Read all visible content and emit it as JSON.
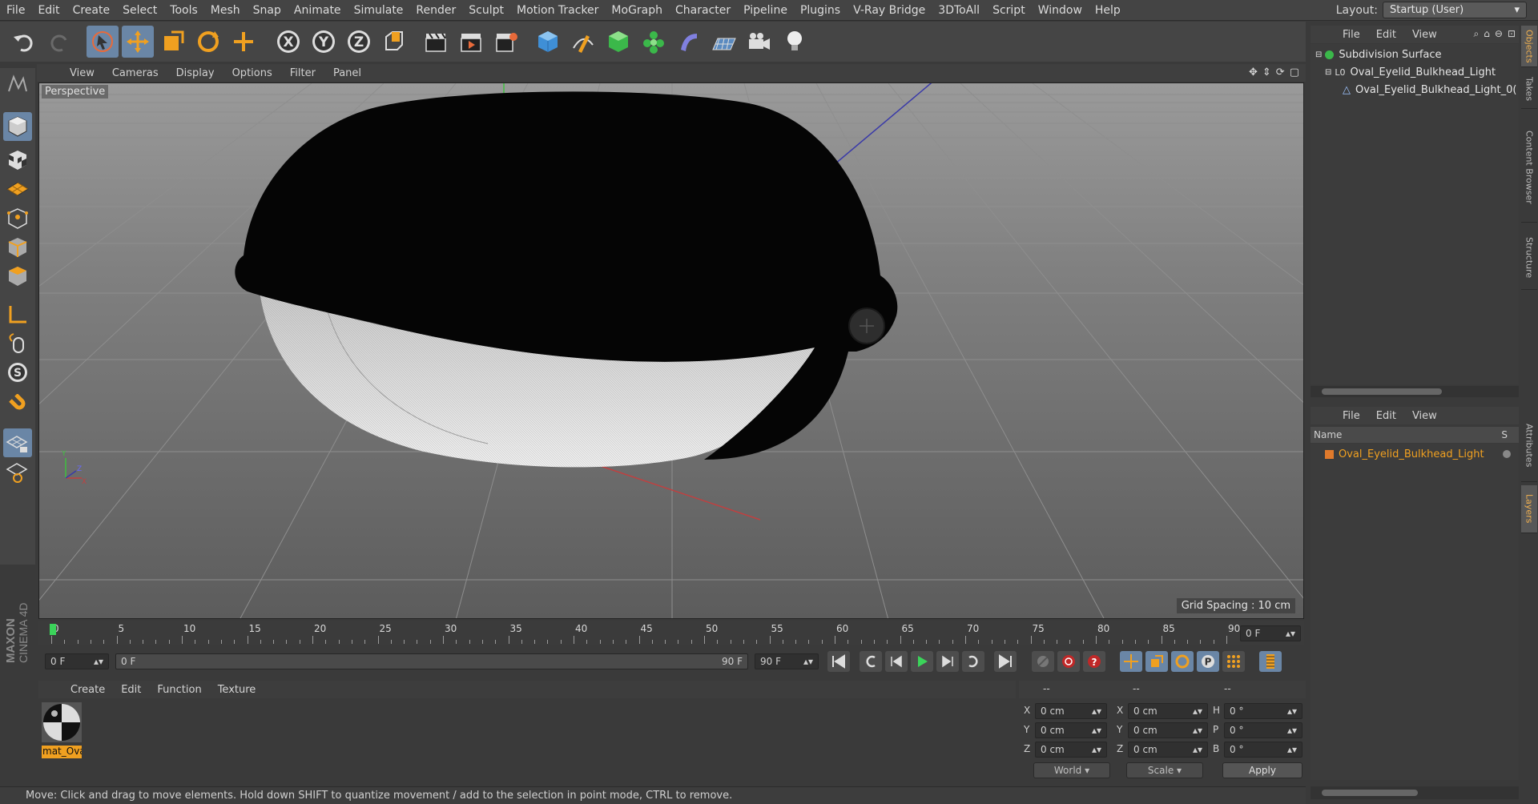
{
  "menubar": {
    "items": [
      "File",
      "Edit",
      "Create",
      "Select",
      "Tools",
      "Mesh",
      "Snap",
      "Animate",
      "Simulate",
      "Render",
      "Sculpt",
      "Motion Tracker",
      "MoGraph",
      "Character",
      "Pipeline",
      "Plugins",
      "V-Ray Bridge",
      "3DToAll",
      "Script",
      "Window",
      "Help"
    ],
    "layout_label": "Layout:",
    "layout_value": "Startup (User)"
  },
  "viewport": {
    "menu": [
      "View",
      "Cameras",
      "Display",
      "Options",
      "Filter",
      "Panel"
    ],
    "label": "Perspective",
    "grid_spacing": "Grid Spacing : 10 cm"
  },
  "timeline": {
    "ticks": [
      "0",
      "5",
      "10",
      "15",
      "20",
      "25",
      "30",
      "35",
      "40",
      "45",
      "50",
      "55",
      "60",
      "65",
      "70",
      "75",
      "80",
      "85",
      "90"
    ],
    "current_frame": "0 F",
    "start_field": "0 F",
    "range_start": "0 F",
    "range_end": "90 F",
    "end_field": "90 F"
  },
  "material": {
    "menu": [
      "Create",
      "Edit",
      "Function",
      "Texture"
    ],
    "items": [
      {
        "name": "mat_Ova"
      }
    ]
  },
  "coordinates": {
    "headers": [
      "--",
      "--",
      "--"
    ],
    "rows": [
      {
        "a_label": "X",
        "a_val": "0 cm",
        "b_label": "X",
        "b_val": "0 cm",
        "c_label": "H",
        "c_val": "0 °"
      },
      {
        "a_label": "Y",
        "a_val": "0 cm",
        "b_label": "Y",
        "b_val": "0 cm",
        "c_label": "P",
        "c_val": "0 °"
      },
      {
        "a_label": "Z",
        "a_val": "0 cm",
        "b_label": "Z",
        "b_val": "0 cm",
        "c_label": "B",
        "c_val": "0 °"
      }
    ],
    "world": "World",
    "scale": "Scale",
    "apply": "Apply"
  },
  "status": "Move: Click and drag to move elements. Hold down SHIFT to quantize movement / add to the selection in point mode, CTRL to remove.",
  "objects": {
    "menu": [
      "File",
      "Edit",
      "View"
    ],
    "items": [
      {
        "name": "Subdivision Surface"
      },
      {
        "name": "Oval_Eyelid_Bulkhead_Light"
      },
      {
        "name": "Oval_Eyelid_Bulkhead_Light_0("
      }
    ]
  },
  "layers": {
    "menu": [
      "File",
      "Edit",
      "View"
    ],
    "col_name": "Name",
    "col_s": "S",
    "items": [
      {
        "name": "Oval_Eyelid_Bulkhead_Light",
        "color": "#e07a2c"
      }
    ]
  },
  "side_tabs": [
    "Objects",
    "Takes",
    "Content Browser",
    "Structure",
    "Attributes",
    "Layers"
  ],
  "brand": "MAXON CINEMA 4D",
  "colors": {
    "accent": "#6a86a6",
    "object_green": "#5fd35f",
    "layer_orange": "#e07a2c",
    "status_green": "#3bd45a"
  }
}
